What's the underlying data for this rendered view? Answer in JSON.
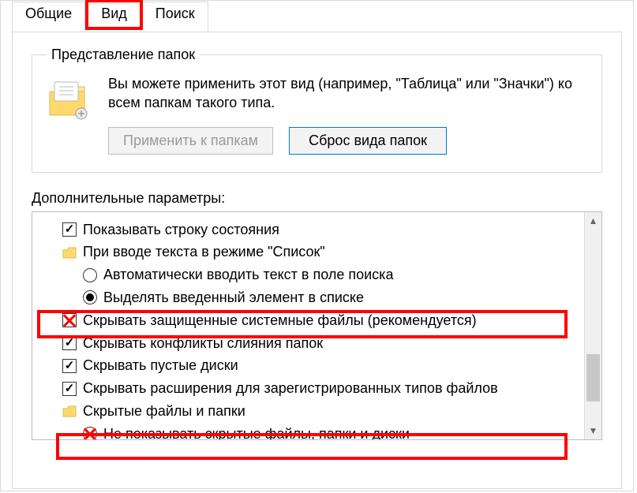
{
  "tabs": {
    "general": "Общие",
    "view": "Вид",
    "search": "Поиск"
  },
  "folderViews": {
    "legend": "Представление папок",
    "description": "Вы можете применить этот вид (например, \"Таблица\" или \"Значки\") ко всем папкам такого типа.",
    "apply_btn": "Применить к папкам",
    "reset_btn": "Сброс вида папок"
  },
  "advanced": {
    "label": "Дополнительные параметры:",
    "items": {
      "show_statusbar": "Показывать строку состояния",
      "search_typing_group": "При вводе текста в режиме \"Список\"",
      "auto_search": "Автоматически вводить текст в поле поиска",
      "select_typed": "Выделять введенный элемент в списке",
      "hide_protected": "Скрывать защищенные системные файлы (рекомендуется)",
      "hide_merge_conflicts": "Скрывать конфликты слияния папок",
      "hide_empty_drives": "Скрывать пустые диски",
      "hide_extensions": "Скрывать расширения для зарегистрированных типов файлов",
      "hidden_group": "Скрытые файлы и папки",
      "dont_show_hidden": "Не показывать скрытые файлы, папки и диски"
    }
  }
}
